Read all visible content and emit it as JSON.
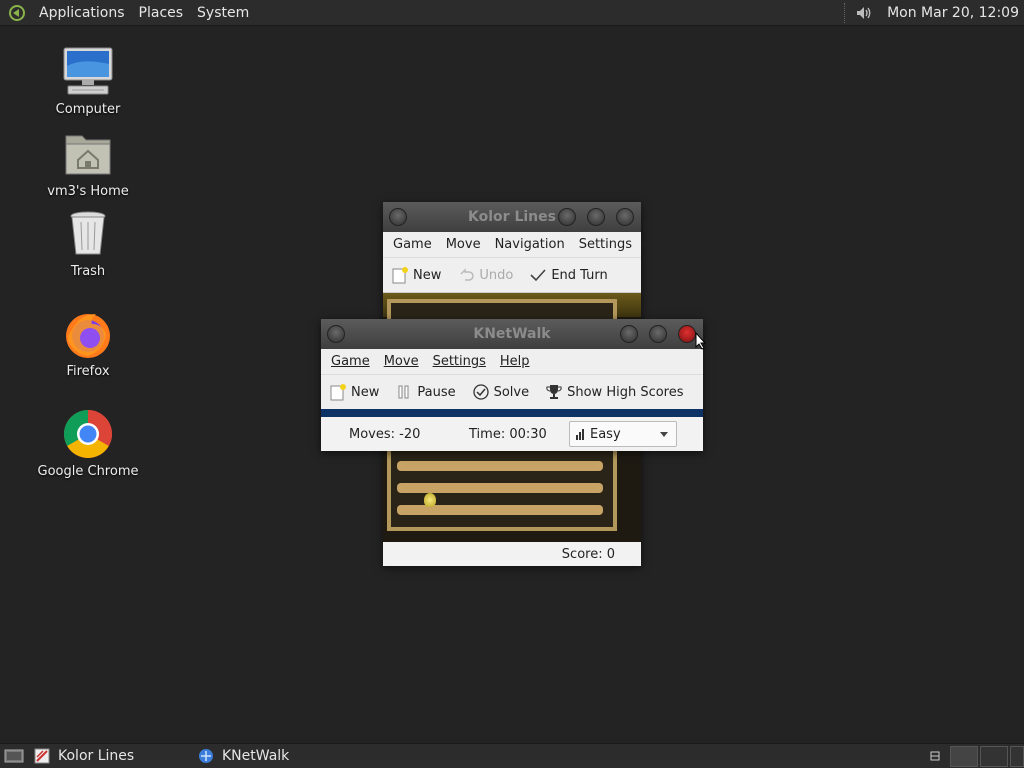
{
  "top_panel": {
    "menus": [
      "Applications",
      "Places",
      "System"
    ],
    "clock": "Mon Mar 20, 12:09"
  },
  "desktop": {
    "icons": [
      {
        "label": "Computer",
        "icon": "computer-icon"
      },
      {
        "label": "vm3's Home",
        "icon": "home-folder-icon"
      },
      {
        "label": "Trash",
        "icon": "trash-icon"
      },
      {
        "label": "Firefox",
        "icon": "firefox-icon"
      },
      {
        "label": "Google Chrome",
        "icon": "chrome-icon"
      }
    ]
  },
  "kolor_lines": {
    "title": "Kolor Lines",
    "menus": [
      "Game",
      "Move",
      "Navigation",
      "Settings"
    ],
    "more": "»",
    "toolbar": {
      "new": "New",
      "undo": "Undo",
      "end_turn": "End Turn"
    },
    "status": "Score: 0"
  },
  "knetwalk": {
    "title": "KNetWalk",
    "menus": [
      "Game",
      "Move",
      "Settings",
      "Help"
    ],
    "toolbar": {
      "new": "New",
      "pause": "Pause",
      "solve": "Solve",
      "high_scores": "Show High Scores"
    },
    "status": {
      "moves": "Moves: -20",
      "time": "Time: 00:30",
      "difficulty": "Easy"
    }
  },
  "taskbar": {
    "items": [
      {
        "label": "Kolor Lines",
        "icon": "kolor-lines-icon"
      },
      {
        "label": "KNetWalk",
        "icon": "knetwalk-icon"
      }
    ]
  },
  "colors": {
    "desktop": "#232323",
    "panel": "#2c2c2c",
    "accent_bar": "#0d3366"
  }
}
